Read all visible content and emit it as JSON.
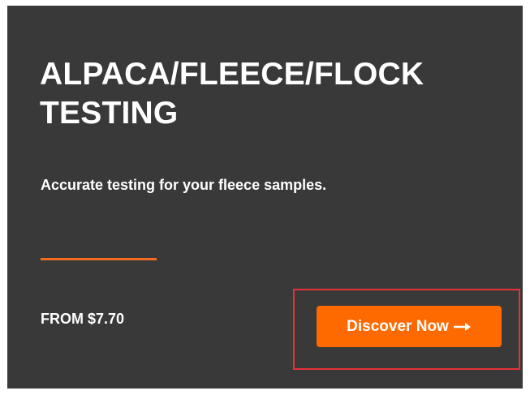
{
  "card": {
    "title": "ALPACA/FLEECE/FLOCK TESTING",
    "subtitle": "Accurate testing for your fleece samples.",
    "price": "FROM $7.70",
    "cta_label": "Discover Now",
    "cta_icon": "arrow-right-icon"
  },
  "colors": {
    "card_background": "#3a3939",
    "accent": "#ff6a00",
    "divider": "#f36c21",
    "highlight_frame": "#e53238",
    "text": "#ffffff"
  }
}
